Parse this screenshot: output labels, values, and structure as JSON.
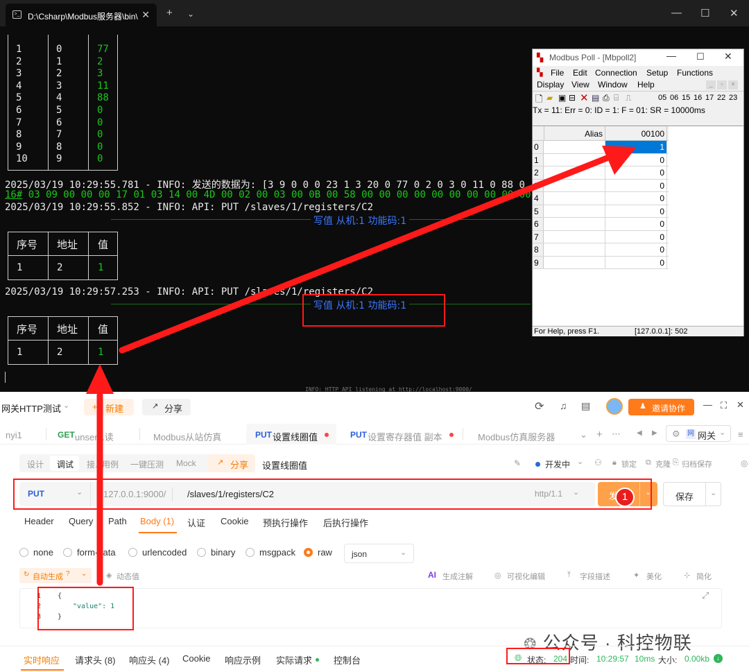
{
  "terminal": {
    "tab_title": "D:\\Csharp\\Modbus服务器\\bin\\",
    "table1": {
      "col1": [
        "1",
        "2",
        "3",
        "4",
        "5",
        "6",
        "7",
        "8",
        "9",
        "10"
      ],
      "col2": [
        "0",
        "1",
        "2",
        "3",
        "4",
        "5",
        "6",
        "7",
        "8",
        "9"
      ],
      "col3": [
        "77",
        "2",
        "3",
        "11",
        "88",
        "0",
        "0",
        "0",
        "0",
        "0"
      ]
    },
    "log1": "2025/03/19 10:29:55.781 - INFO: 发送的数据为: [3 9 0 0 0 23 1 3 20 0 77 0 2 0 3 0 11 0 88 0",
    "hex_prefix": "16#",
    "hex_line": " 03 09 00 00 00 17 01 03 14 00 4D 00 02 00 03 00 0B 00 58 00 00 00 00 00 00 00 00 00 00",
    "log2": "2025/03/19 10:29:55.852 - INFO: API: PUT /slaves/1/registers/C2",
    "banner1": "写值 从机:1 功能码:1",
    "table2": {
      "h1": "序号",
      "h2": "地址",
      "h3": "值",
      "c1": "1",
      "c2": "2",
      "c3": "1"
    },
    "log3": "2025/03/19 10:29:57.253 - INFO: API: PUT /slaves/1/registers/C2",
    "banner2": "写值 从机:1 功能码:1",
    "table3": {
      "h1": "序号",
      "h2": "地址",
      "h3": "值",
      "c1": "1",
      "c2": "2",
      "c3": "1"
    },
    "overlap_text": "INFO: HTTP API listening at http://localhost:9000/"
  },
  "modbus_poll": {
    "title": "Modbus Poll - [Mbpoll2]",
    "menu_row1": [
      "File",
      "Edit",
      "Connection",
      "Setup",
      "Functions"
    ],
    "menu_row2": [
      "Display",
      "View",
      "Window",
      "Help"
    ],
    "toolbar_numbers": [
      "05",
      "06",
      "15",
      "16",
      "17",
      "22",
      "23"
    ],
    "status_line": "Tx = 11: Err = 0: ID = 1: F = 01: SR = 10000ms",
    "col_alias": "Alias",
    "col_addr": "00100",
    "rows": [
      {
        "idx": "0",
        "val": "1"
      },
      {
        "idx": "1",
        "val": "0"
      },
      {
        "idx": "2",
        "val": "0"
      },
      {
        "idx": "3",
        "val": "0"
      },
      {
        "idx": "4",
        "val": "0"
      },
      {
        "idx": "5",
        "val": "0"
      },
      {
        "idx": "6",
        "val": "0"
      },
      {
        "idx": "7",
        "val": "0"
      },
      {
        "idx": "8",
        "val": "0"
      },
      {
        "idx": "9",
        "val": "0"
      }
    ],
    "footer_help": "For Help, press F1.",
    "footer_conn": "[127.0.0.1]: 502"
  },
  "client": {
    "project": "网关HTTP测试",
    "new_btn": "新建",
    "share_btn": "分享",
    "invite_btn": "邀请协作",
    "tabs": [
      {
        "label": "nyi1"
      },
      {
        "method": "GET",
        "label": "unser...读"
      },
      {
        "label": "Modbus从站仿真"
      },
      {
        "method": "PUT",
        "label": "设置线圈值"
      },
      {
        "method": "PUT",
        "label": "设置寄存器值 副本"
      },
      {
        "label": "Modbus仿真服务器"
      }
    ],
    "env": "网关",
    "subtabs": [
      "设计",
      "调试",
      "接...用例",
      "一键压测",
      "Mock"
    ],
    "share2": "分享",
    "api_name": "设置线圈值",
    "dev_status": "开发中",
    "actions": [
      "锁定",
      "克隆",
      "归档保存"
    ],
    "method": "PUT",
    "base_url": "127.0.0.1:9000/",
    "path": "/slaves/1/registers/C2",
    "http_ver": "http/1.1",
    "send_btn": "发",
    "badge": "1",
    "save_btn": "保存",
    "param_tabs": [
      "Header",
      "Query",
      "Path",
      "Body (1)",
      "认证",
      "Cookie",
      "预执行操作",
      "后执行操作"
    ],
    "body_types": [
      "none",
      "form-data",
      "urlencoded",
      "binary",
      "msgpack",
      "raw"
    ],
    "format": "json",
    "auto_gen": "自动生成",
    "dynamic": "动态值",
    "tools": [
      "生成注解",
      "可视化编辑",
      "字段描述",
      "美化",
      "简化"
    ],
    "code": [
      "{",
      "\"value\": 1",
      "}"
    ],
    "resp_tabs": [
      "实时响应",
      "请求头 (8)",
      "响应头 (4)",
      "Cookie",
      "响应示例",
      "实际请求",
      "控制台"
    ],
    "status_label": "状态:",
    "status_code": "204",
    "time_label": "时间:",
    "time_val": "10:29:57",
    "duration": "10ms",
    "size_label": "大小:",
    "size_val": "0.00kb",
    "watermark": "公众号 · 科控物联"
  },
  "colors": {
    "accent": "#ff7a1a",
    "annotation": "#ff1a1a",
    "terminal_green": "#19c919",
    "selection_blue": "#0078d7"
  }
}
